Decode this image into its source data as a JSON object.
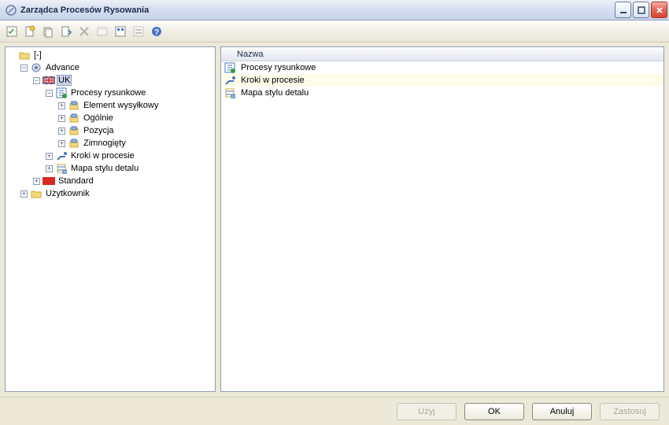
{
  "window": {
    "title": "Zarządca Procesów Rysowania"
  },
  "toolbar": {
    "items": [
      {
        "name": "checklist-icon"
      },
      {
        "name": "new-doc-icon"
      },
      {
        "name": "copy-icon"
      },
      {
        "name": "paste-icon"
      },
      {
        "name": "delete-icon",
        "disabled": true
      },
      {
        "name": "properties-icon",
        "disabled": true
      },
      {
        "name": "view-a-icon"
      },
      {
        "name": "view-b-icon",
        "disabled": true
      },
      {
        "name": "help-icon"
      }
    ]
  },
  "tree": {
    "root": "[-]",
    "nodes": {
      "advance": "Advance",
      "uk": "UK",
      "procesy": "Procesy rysunkowe",
      "element": "Element wysyłkowy",
      "ogolnie": "Ogólnie",
      "pozycja": "Pozycja",
      "zimno": "Zimnogięty",
      "kroki": "Kroki w procesie",
      "mapa": "Mapa stylu detalu",
      "standard": "Standard",
      "uzytkownik": "Użytkownik"
    }
  },
  "list": {
    "header": "Nazwa",
    "rows": [
      {
        "label": "Procesy rysunkowe",
        "icon": "process-icon"
      },
      {
        "label": "Kroki w procesie",
        "icon": "steps-icon"
      },
      {
        "label": "Mapa stylu detalu",
        "icon": "map-icon"
      }
    ]
  },
  "buttons": {
    "use": "Użyj",
    "ok": "OK",
    "cancel": "Anuluj",
    "apply": "Zastosuj"
  }
}
